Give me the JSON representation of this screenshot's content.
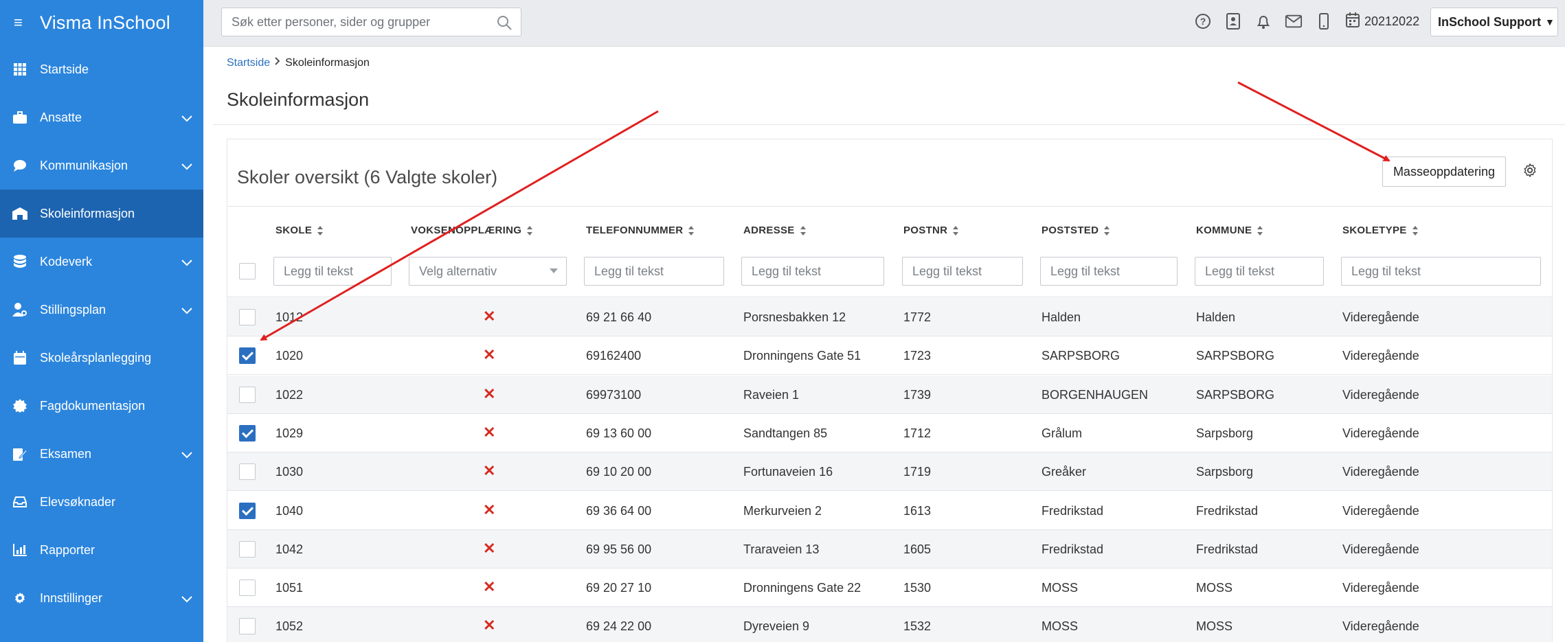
{
  "app": {
    "title": "Visma InSchool",
    "menu_icon": "hamburger-icon"
  },
  "sidebar": {
    "items": [
      {
        "label": "Startside",
        "icon": "grid-icon",
        "has_children": false,
        "active": false
      },
      {
        "label": "Ansatte",
        "icon": "briefcase-icon",
        "has_children": true,
        "active": false
      },
      {
        "label": "Kommunikasjon",
        "icon": "chat-bubble-icon",
        "has_children": true,
        "active": false
      },
      {
        "label": "Skoleinformasjon",
        "icon": "school-icon",
        "has_children": false,
        "active": true
      },
      {
        "label": "Kodeverk",
        "icon": "database-icon",
        "has_children": true,
        "active": false
      },
      {
        "label": "Stillingsplan",
        "icon": "user-cog-icon",
        "has_children": true,
        "active": false
      },
      {
        "label": "Skoleårsplanlegging",
        "icon": "calendar-icon",
        "has_children": false,
        "active": false
      },
      {
        "label": "Fagdokumentasjon",
        "icon": "badge-icon",
        "has_children": false,
        "active": false
      },
      {
        "label": "Eksamen",
        "icon": "exam-icon",
        "has_children": true,
        "active": false
      },
      {
        "label": "Elevsøknader",
        "icon": "inbox-icon",
        "has_children": false,
        "active": false
      },
      {
        "label": "Rapporter",
        "icon": "chart-icon",
        "has_children": false,
        "active": false
      },
      {
        "label": "Innstillinger",
        "icon": "gear-icon",
        "has_children": true,
        "active": false
      }
    ]
  },
  "topbar": {
    "search_placeholder": "Søk etter personer, sider og grupper",
    "date": "20212022",
    "user": "InSchool Support",
    "icons": [
      "help-icon",
      "contact-card-icon",
      "bell-icon",
      "mail-icon",
      "mobile-icon",
      "calendar-icon"
    ]
  },
  "breadcrumb": {
    "home": "Startside",
    "current": "Skoleinformasjon"
  },
  "page": {
    "title": "Skoleinformasjon"
  },
  "card": {
    "title": "Skoler oversikt (6 Valgte skoler)",
    "mass_update_label": "Masseoppdatering"
  },
  "table": {
    "columns": [
      {
        "label": "SKOLE",
        "filter": "Legg til tekst"
      },
      {
        "label": "VOKSENOPPLÆRING",
        "filter": "Velg alternativ"
      },
      {
        "label": "TELEFONNUMMER",
        "filter": "Legg til tekst"
      },
      {
        "label": "ADRESSE",
        "filter": "Legg til tekst"
      },
      {
        "label": "POSTNR",
        "filter": "Legg til tekst"
      },
      {
        "label": "POSTSTED",
        "filter": "Legg til tekst"
      },
      {
        "label": "KOMMUNE",
        "filter": "Legg til tekst"
      },
      {
        "label": "SKOLETYPE",
        "filter": "Legg til tekst"
      }
    ],
    "rows": [
      {
        "checked": false,
        "skole": "1012",
        "voksen": "✕",
        "telefon": "69 21 66 40",
        "adresse": "Porsnesbakken 12",
        "postnr": "1772",
        "poststed": "Halden",
        "kommune": "Halden",
        "skoletype": "Videregående"
      },
      {
        "checked": true,
        "skole": "1020",
        "voksen": "✕",
        "telefon": "69162400",
        "adresse": "Dronningens Gate 51",
        "postnr": "1723",
        "poststed": "SARPSBORG",
        "kommune": "SARPSBORG",
        "skoletype": "Videregående"
      },
      {
        "checked": false,
        "skole": "1022",
        "voksen": "✕",
        "telefon": "69973100",
        "adresse": "Raveien 1",
        "postnr": "1739",
        "poststed": "BORGENHAUGEN",
        "kommune": "SARPSBORG",
        "skoletype": "Videregående"
      },
      {
        "checked": true,
        "skole": "1029",
        "voksen": "✕",
        "telefon": "69 13 60 00",
        "adresse": "Sandtangen 85",
        "postnr": "1712",
        "poststed": "Grålum",
        "kommune": "Sarpsborg",
        "skoletype": "Videregående"
      },
      {
        "checked": false,
        "skole": "1030",
        "voksen": "✕",
        "telefon": "69 10 20 00",
        "adresse": "Fortunaveien 16",
        "postnr": "1719",
        "poststed": "Greåker",
        "kommune": "Sarpsborg",
        "skoletype": "Videregående"
      },
      {
        "checked": true,
        "skole": "1040",
        "voksen": "✕",
        "telefon": "69 36 64 00",
        "adresse": "Merkurveien 2",
        "postnr": "1613",
        "poststed": "Fredrikstad",
        "kommune": "Fredrikstad",
        "skoletype": "Videregående"
      },
      {
        "checked": false,
        "skole": "1042",
        "voksen": "✕",
        "telefon": "69 95 56 00",
        "adresse": "Traraveien 13",
        "postnr": "1605",
        "poststed": "Fredrikstad",
        "kommune": "Fredrikstad",
        "skoletype": "Videregående"
      },
      {
        "checked": false,
        "skole": "1051",
        "voksen": "✕",
        "telefon": "69 20 27 10",
        "adresse": "Dronningens Gate 22",
        "postnr": "1530",
        "poststed": "MOSS",
        "kommune": "MOSS",
        "skoletype": "Videregående"
      },
      {
        "checked": false,
        "skole": "1052",
        "voksen": "✕",
        "telefon": "69 24 22 00",
        "adresse": "Dyreveien 9",
        "postnr": "1532",
        "poststed": "MOSS",
        "kommune": "MOSS",
        "skoletype": "Videregående"
      }
    ]
  },
  "annotations": {
    "arrow_color": "#e02020"
  }
}
